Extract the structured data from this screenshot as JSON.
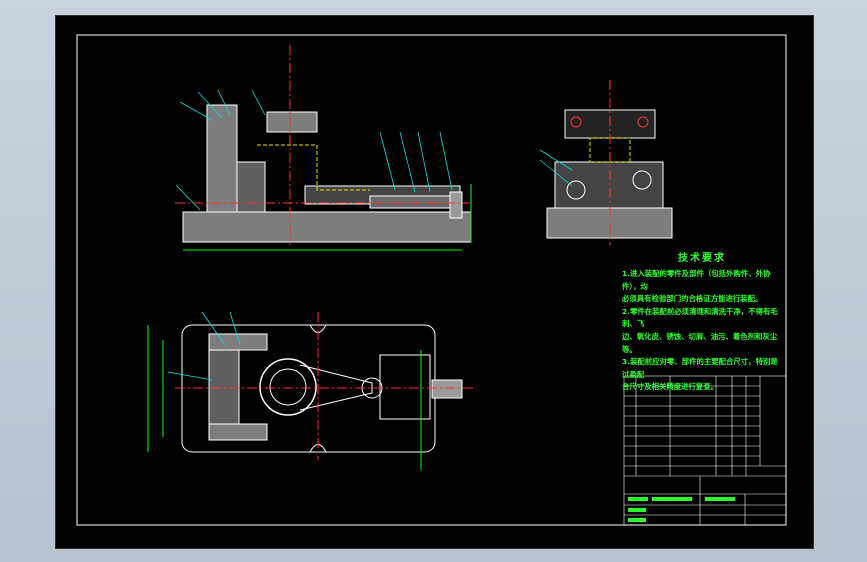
{
  "colors": {
    "desktop": "#c4ceda",
    "canvas": "#000000",
    "outline": "#ffffff",
    "section_hatch": "#8a8a8a",
    "dimension": "#00ff00",
    "center_line": "#ff3030",
    "hidden_line": "#e6e600",
    "leader": "#00e0e0"
  },
  "technical_requirements": {
    "title": "技术要求",
    "lines": [
      "1.进入装配的零件及部件（包括外购件、外协件），均",
      "必须具有检验部门的合格证方能进行装配。",
      "2.零件在装配前必须清理和清洗干净，不得有毛刺、飞",
      "边、氧化皮、锈蚀、切屑、油污、着色剂和灰尘等。",
      "3.装配前应对零、部件的主要配合尺寸，特别是过盈配",
      "合尺寸及相关精度进行复查。"
    ]
  },
  "icons": [
    "drawing-border",
    "title-block-grid"
  ]
}
